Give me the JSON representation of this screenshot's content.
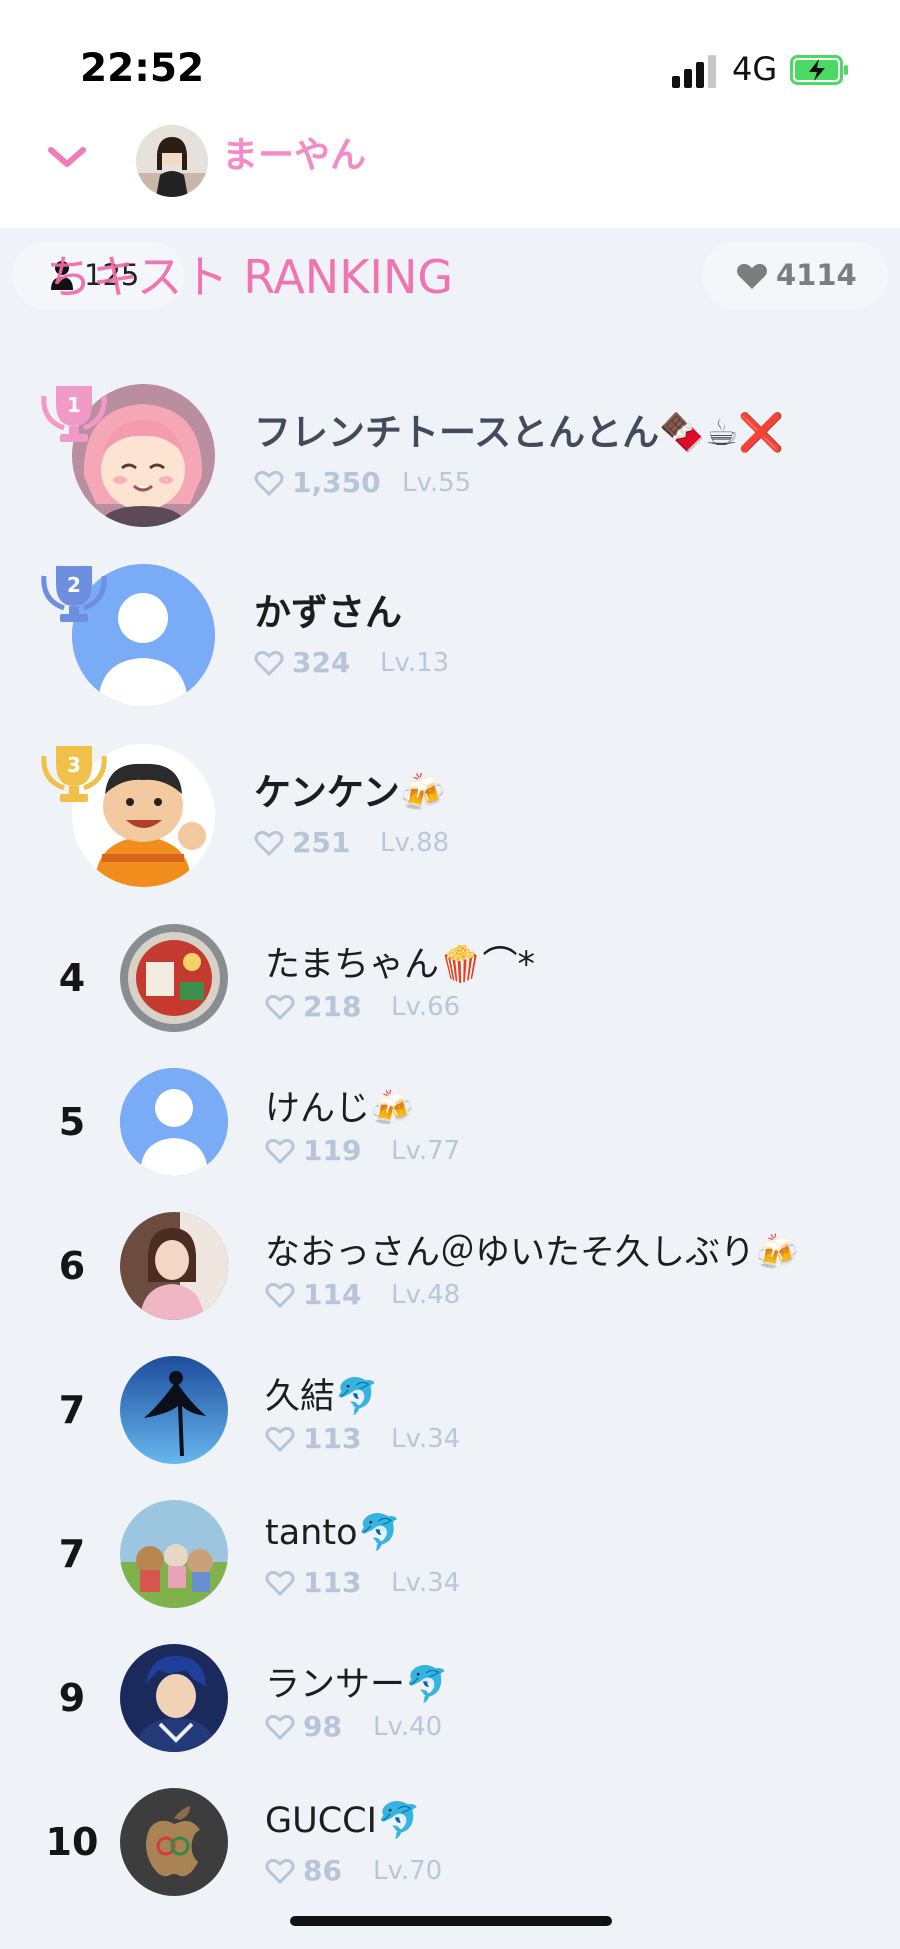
{
  "status_bar": {
    "time": "22:52",
    "network": "4G"
  },
  "header": {
    "host_name": "まーやん"
  },
  "stats": {
    "viewers": "125",
    "likes": "4114"
  },
  "ranking_title": "ちキスト RANKING",
  "colors": {
    "accent_pink": "#f06aa9",
    "gold": "#f0c04a",
    "silver_blue": "#6e8fe0",
    "rank1_pink": "#f29ac7"
  },
  "ranking": [
    {
      "rank": "1",
      "name": "フレンチトースとんとん🍫☕❌",
      "likes": "1,350",
      "level": "Lv.55",
      "avatar": "anime-girl"
    },
    {
      "rank": "2",
      "name": "かずさん",
      "likes": "324",
      "level": "Lv.13",
      "avatar": "default-user"
    },
    {
      "rank": "3",
      "name": "ケンケン🍻",
      "likes": "251",
      "level": "Lv.88",
      "avatar": "cartoon-boy"
    },
    {
      "rank": "4",
      "name": "たまちゃん🍿⌒*",
      "likes": "218",
      "level": "Lv.66",
      "avatar": "noodle-cup"
    },
    {
      "rank": "5",
      "name": "けんじ🍻",
      "likes": "119",
      "level": "Lv.77",
      "avatar": "default-user"
    },
    {
      "rank": "6",
      "name": "なおっさん＠ゆいたそ久しぶり🍻",
      "likes": "114",
      "level": "Lv.48",
      "avatar": "photo-person"
    },
    {
      "rank": "7",
      "name": "久結🐬",
      "likes": "113",
      "level": "Lv.34",
      "avatar": "aquarium-silhouette"
    },
    {
      "rank": "7",
      "name": "tanto🐬",
      "likes": "113",
      "level": "Lv.34",
      "avatar": "toy-animals"
    },
    {
      "rank": "9",
      "name": "ランサー🐬",
      "likes": "98",
      "level": "Lv.40",
      "avatar": "anime-warrior"
    },
    {
      "rank": "10",
      "name": "GUCCI🐬",
      "likes": "86",
      "level": "Lv.70",
      "avatar": "brand-logo"
    }
  ]
}
